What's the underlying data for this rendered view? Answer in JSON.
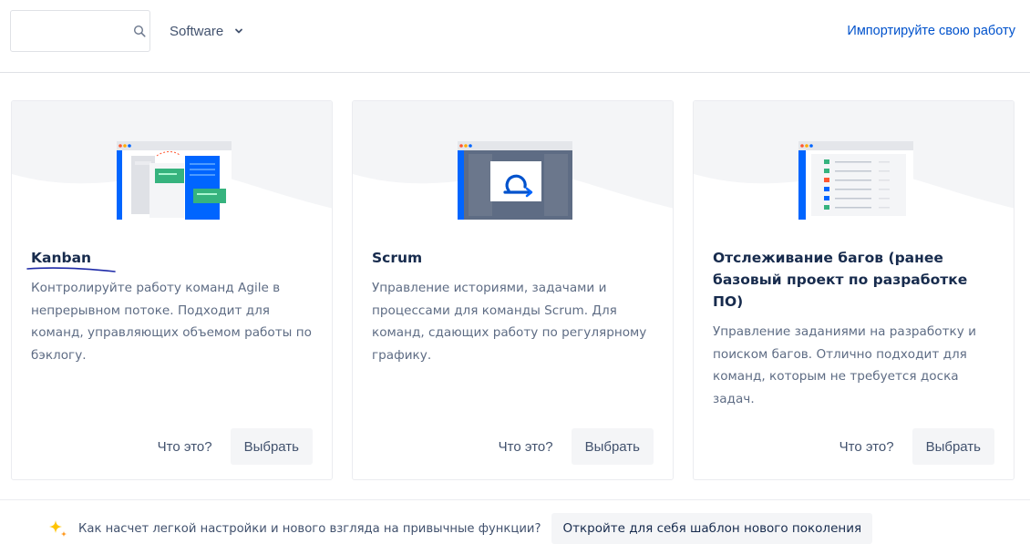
{
  "search": {
    "value": "",
    "placeholder": ""
  },
  "category": {
    "selected": "Software"
  },
  "import_link": "Импортируйте свою работу",
  "cards": [
    {
      "title": "Kanban",
      "description": "Контролируйте работу команд Agile в непрерывном потоке. Подходит для команд, управляющих объемом работы по бэклогу.",
      "what_label": "Что это?",
      "select_label": "Выбрать"
    },
    {
      "title": "Scrum",
      "description": "Управление историями, задачами и процессами для команды Scrum. Для команд, сдающих работу по регулярному графику.",
      "what_label": "Что это?",
      "select_label": "Выбрать"
    },
    {
      "title": "Отслеживание багов (ранее базовый проект по разработке ПО)",
      "description": "Управление заданиями на разработку и поиском багов. Отлично подходит для команд, которым не требуется доска задач.",
      "what_label": "Что это?",
      "select_label": "Выбрать"
    }
  ],
  "promo": {
    "text": "Как насчет легкой настройки и нового взгляда на привычные функции?",
    "button_label": "Откройте для себя шаблон нового поколения"
  },
  "colors": {
    "link": "#0052cc",
    "primary_blue": "#0065ff",
    "green": "#36b37e",
    "sparkle": "#ffc400",
    "annotation_ink": "#1e2aa8"
  }
}
